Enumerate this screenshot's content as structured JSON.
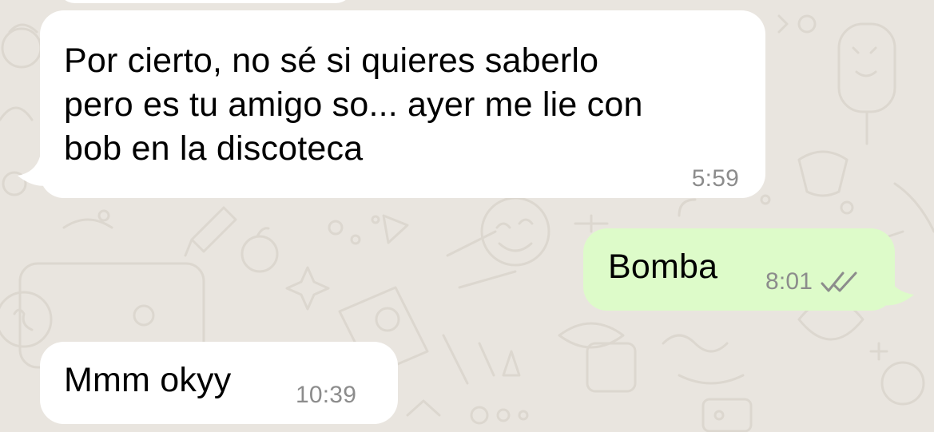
{
  "chat": {
    "messages": [
      {
        "direction": "incoming",
        "text": "",
        "time": ""
      },
      {
        "direction": "incoming",
        "text": "Por cierto, no sé si quieres saberlo\npero es tu amigo so... ayer me lie con\nbob en la discoteca",
        "time": "5:59"
      },
      {
        "direction": "outgoing",
        "text": "Bomba",
        "time": "8:01",
        "status_icon": "double-check-icon"
      },
      {
        "direction": "incoming",
        "text": "Mmm okyy",
        "time": "10:39"
      }
    ]
  },
  "colors": {
    "background": "#e9e5df",
    "incoming_bubble": "#ffffff",
    "outgoing_bubble": "#ddfbc9",
    "timestamp": "#8c8c8c",
    "read_check": "#8c8c8c"
  }
}
